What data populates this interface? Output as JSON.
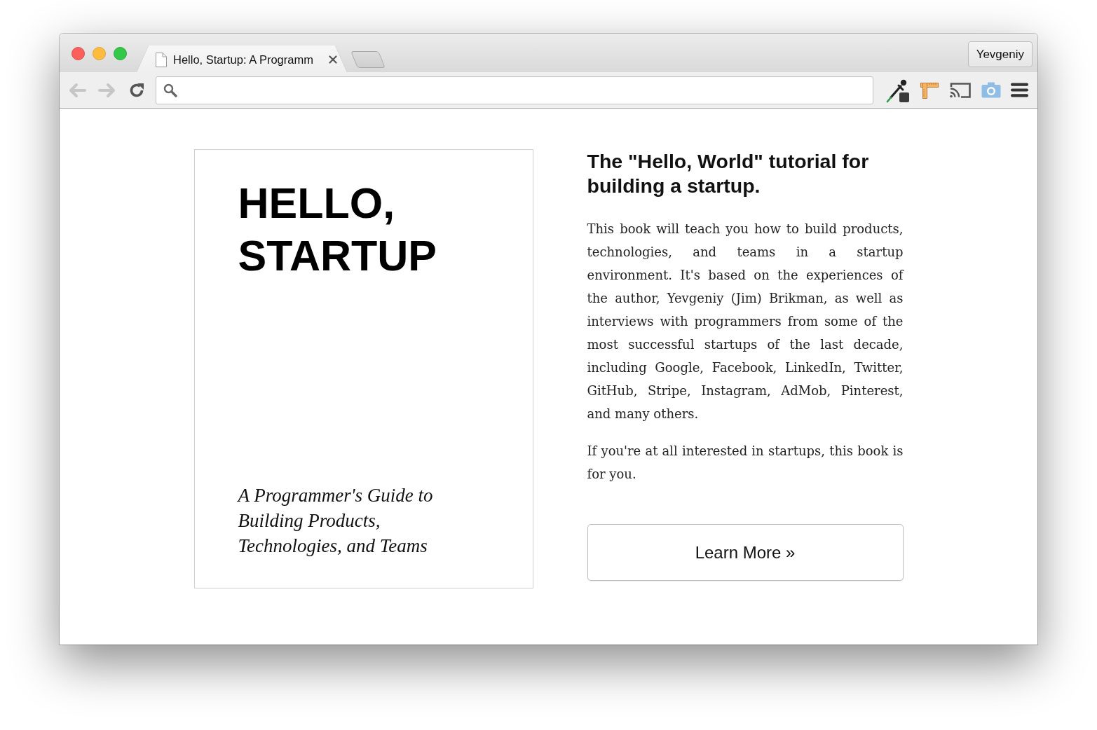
{
  "browser": {
    "tabs": [
      {
        "title": "Hello, Startup: A Programm",
        "selected": true
      }
    ],
    "profile": "Yevgeniy",
    "nav_buttons": [
      {
        "kind": "back",
        "disabled": true
      },
      {
        "kind": "forward",
        "disabled": true
      },
      {
        "kind": "reload",
        "disabled": false
      }
    ]
  },
  "book_cover": {
    "title": "HELLO, STARTUP",
    "subtitle": "A Programmer's Guide to Building Products, Technologies, and Teams"
  },
  "intro": {
    "heading": "The \"Hello, World\" tutorial for building a startup.",
    "paragraphs": [
      "This book will teach you how to build products, technologies, and teams in a startup environment. It's based on the experiences of the author, Yevgeniy (Jim) Brikman, as well as interviews with programmers from some of the most successful startups of the last decade, including Google, Facebook, LinkedIn, Twitter, GitHub, Stripe, Instagram, AdMob, Pinterest, and many others.",
      "If you're at all interested in startups, this book is for you."
    ],
    "button": "Learn More »"
  }
}
